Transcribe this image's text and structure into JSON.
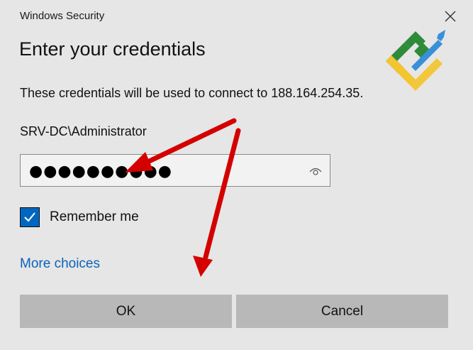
{
  "window": {
    "title": "Windows Security",
    "close_symbol": "✕"
  },
  "dialog": {
    "heading": "Enter your credentials",
    "description": "These credentials will be used to connect to 188.164.254.35.",
    "username": "SRV-DC\\Administrator",
    "password_masked": "●●●●●●●●●●",
    "remember_label": "Remember me",
    "remember_checked": true,
    "more_choices": "More choices",
    "ok_label": "OK",
    "cancel_label": "Cancel"
  },
  "colors": {
    "accent": "#0067c0",
    "link": "#0a64b8",
    "arrow": "#d40000",
    "button": "#b8b8b8",
    "background": "#e6e6e6"
  },
  "icons": [
    "close-icon",
    "eye-icon",
    "checkmark-icon",
    "brand-logo-icon"
  ]
}
